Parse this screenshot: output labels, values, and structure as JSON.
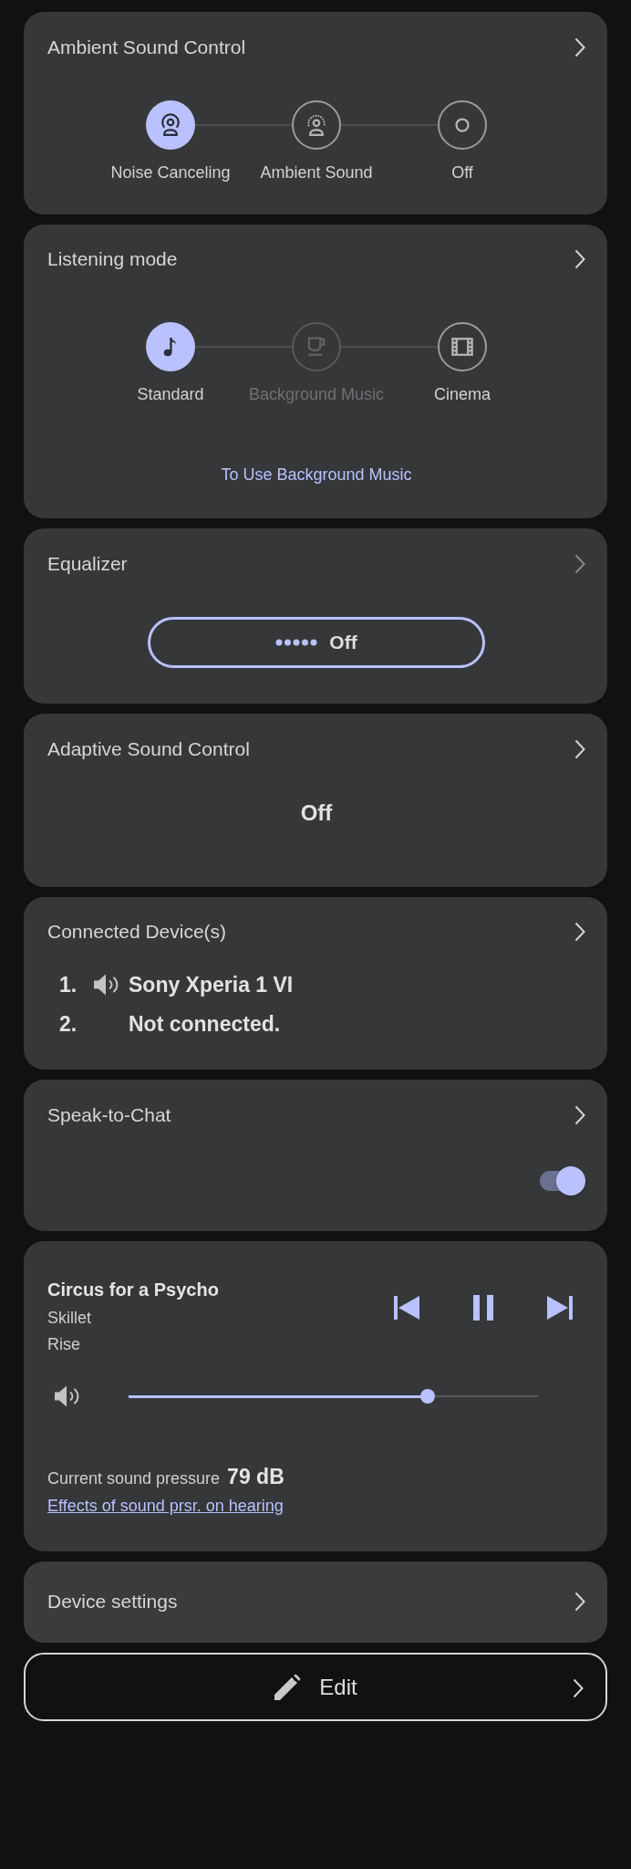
{
  "ambient_sound_control": {
    "title": "Ambient Sound Control",
    "modes": [
      {
        "label": "Noise Canceling",
        "selected": true
      },
      {
        "label": "Ambient Sound",
        "selected": false
      },
      {
        "label": "Off",
        "selected": false
      }
    ]
  },
  "listening_mode": {
    "title": "Listening mode",
    "modes": [
      {
        "label": "Standard",
        "selected": true,
        "disabled": false
      },
      {
        "label": "Background Music",
        "selected": false,
        "disabled": true
      },
      {
        "label": "Cinema",
        "selected": false,
        "disabled": false
      }
    ],
    "link": "To Use Background Music"
  },
  "equalizer": {
    "title": "Equalizer",
    "arrow_disabled": true,
    "preset_button": "Off"
  },
  "adaptive_sound_control": {
    "title": "Adaptive Sound Control",
    "value": "Off"
  },
  "connected_devices": {
    "title": "Connected Device(s)",
    "devices": [
      {
        "number": "1.",
        "name": "Sony Xperia 1 VI",
        "active": true
      },
      {
        "number": "2.",
        "name": "Not connected.",
        "active": false
      }
    ]
  },
  "speak_to_chat": {
    "title": "Speak-to-Chat",
    "on": true
  },
  "player": {
    "track": "Circus for a Psycho",
    "artist": "Skillet",
    "album": "Rise",
    "playing": true,
    "volume": {
      "level": 0.73
    },
    "sound_pressure_label": "Current sound pressure",
    "sound_pressure_value": "79 dB",
    "hearing_link": "Effects of sound prsr. on hearing"
  },
  "device_settings": {
    "title": "Device settings"
  },
  "edit_button": {
    "label": "Edit"
  }
}
